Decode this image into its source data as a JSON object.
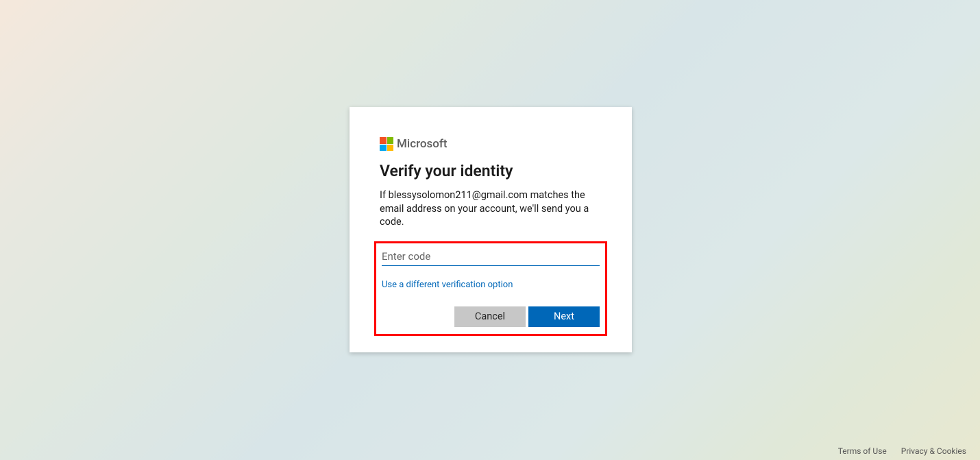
{
  "brand": {
    "name": "Microsoft"
  },
  "card": {
    "heading": "Verify your identity",
    "description": "If blessysolomon211@gmail.com matches the email address on your account, we'll send you a code.",
    "code_placeholder": "Enter code",
    "alt_option": "Use a different verification option",
    "cancel_label": "Cancel",
    "next_label": "Next"
  },
  "footer": {
    "terms": "Terms of Use",
    "privacy": "Privacy & Cookies"
  }
}
